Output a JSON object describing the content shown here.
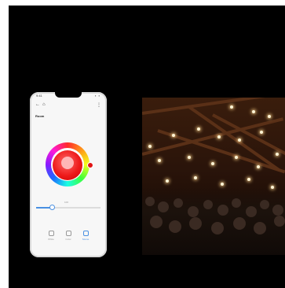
{
  "phone": {
    "status_time": "9:41",
    "status_icons": "▪ ▪",
    "nav": {
      "back_icon": "back-icon",
      "home_icon": "home-icon",
      "more_icon": "more-icon"
    },
    "device_title": "Room",
    "slider_label": "100",
    "brightness": 0.25,
    "bottom_nav": [
      {
        "label": "White",
        "icon": "sun-icon",
        "active": false
      },
      {
        "label": "Color",
        "icon": "palette-icon",
        "active": false
      },
      {
        "label": "Scene",
        "icon": "scene-icon",
        "active": true
      }
    ],
    "accent_color": "#4a90e2",
    "bulb_color": "#ee1b1b"
  },
  "photo": {
    "subject": "string-lights-crowd"
  }
}
